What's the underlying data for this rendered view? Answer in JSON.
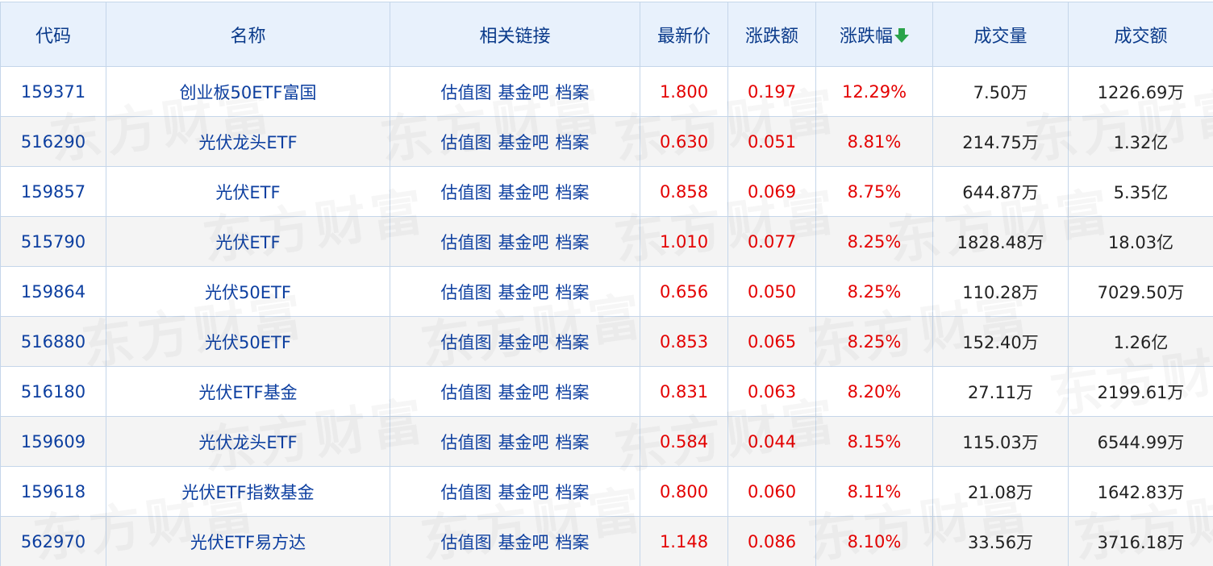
{
  "columns": [
    "代码",
    "名称",
    "相关链接",
    "最新价",
    "涨跌额",
    "涨跌幅",
    "成交量",
    "成交额"
  ],
  "sort_indicator": "arrow-down-icon",
  "accent_colors": {
    "up": "#e40000",
    "link": "#0d3fa0",
    "sort_arrow": "#2aa34a"
  },
  "links": [
    "估值图",
    "基金吧",
    "档案"
  ],
  "rows": [
    {
      "code": "159371",
      "name": "创业板50ETF富国",
      "price": "1.800",
      "change": "0.197",
      "pct": "12.29%",
      "volume": "7.50万",
      "amount": "1226.69万"
    },
    {
      "code": "516290",
      "name": "光伏龙头ETF",
      "price": "0.630",
      "change": "0.051",
      "pct": "8.81%",
      "volume": "214.75万",
      "amount": "1.32亿"
    },
    {
      "code": "159857",
      "name": "光伏ETF",
      "price": "0.858",
      "change": "0.069",
      "pct": "8.75%",
      "volume": "644.87万",
      "amount": "5.35亿"
    },
    {
      "code": "515790",
      "name": "光伏ETF",
      "price": "1.010",
      "change": "0.077",
      "pct": "8.25%",
      "volume": "1828.48万",
      "amount": "18.03亿"
    },
    {
      "code": "159864",
      "name": "光伏50ETF",
      "price": "0.656",
      "change": "0.050",
      "pct": "8.25%",
      "volume": "110.28万",
      "amount": "7029.50万"
    },
    {
      "code": "516880",
      "name": "光伏50ETF",
      "price": "0.853",
      "change": "0.065",
      "pct": "8.25%",
      "volume": "152.40万",
      "amount": "1.26亿"
    },
    {
      "code": "516180",
      "name": "光伏ETF基金",
      "price": "0.831",
      "change": "0.063",
      "pct": "8.20%",
      "volume": "27.11万",
      "amount": "2199.61万"
    },
    {
      "code": "159609",
      "name": "光伏龙头ETF",
      "price": "0.584",
      "change": "0.044",
      "pct": "8.15%",
      "volume": "115.03万",
      "amount": "6544.99万"
    },
    {
      "code": "159618",
      "name": "光伏ETF指数基金",
      "price": "0.800",
      "change": "0.060",
      "pct": "8.11%",
      "volume": "21.08万",
      "amount": "1642.83万"
    },
    {
      "code": "562970",
      "name": "光伏ETF易方达",
      "price": "1.148",
      "change": "0.086",
      "pct": "8.10%",
      "volume": "33.56万",
      "amount": "3716.18万"
    }
  ],
  "watermark_text": "东方财富"
}
